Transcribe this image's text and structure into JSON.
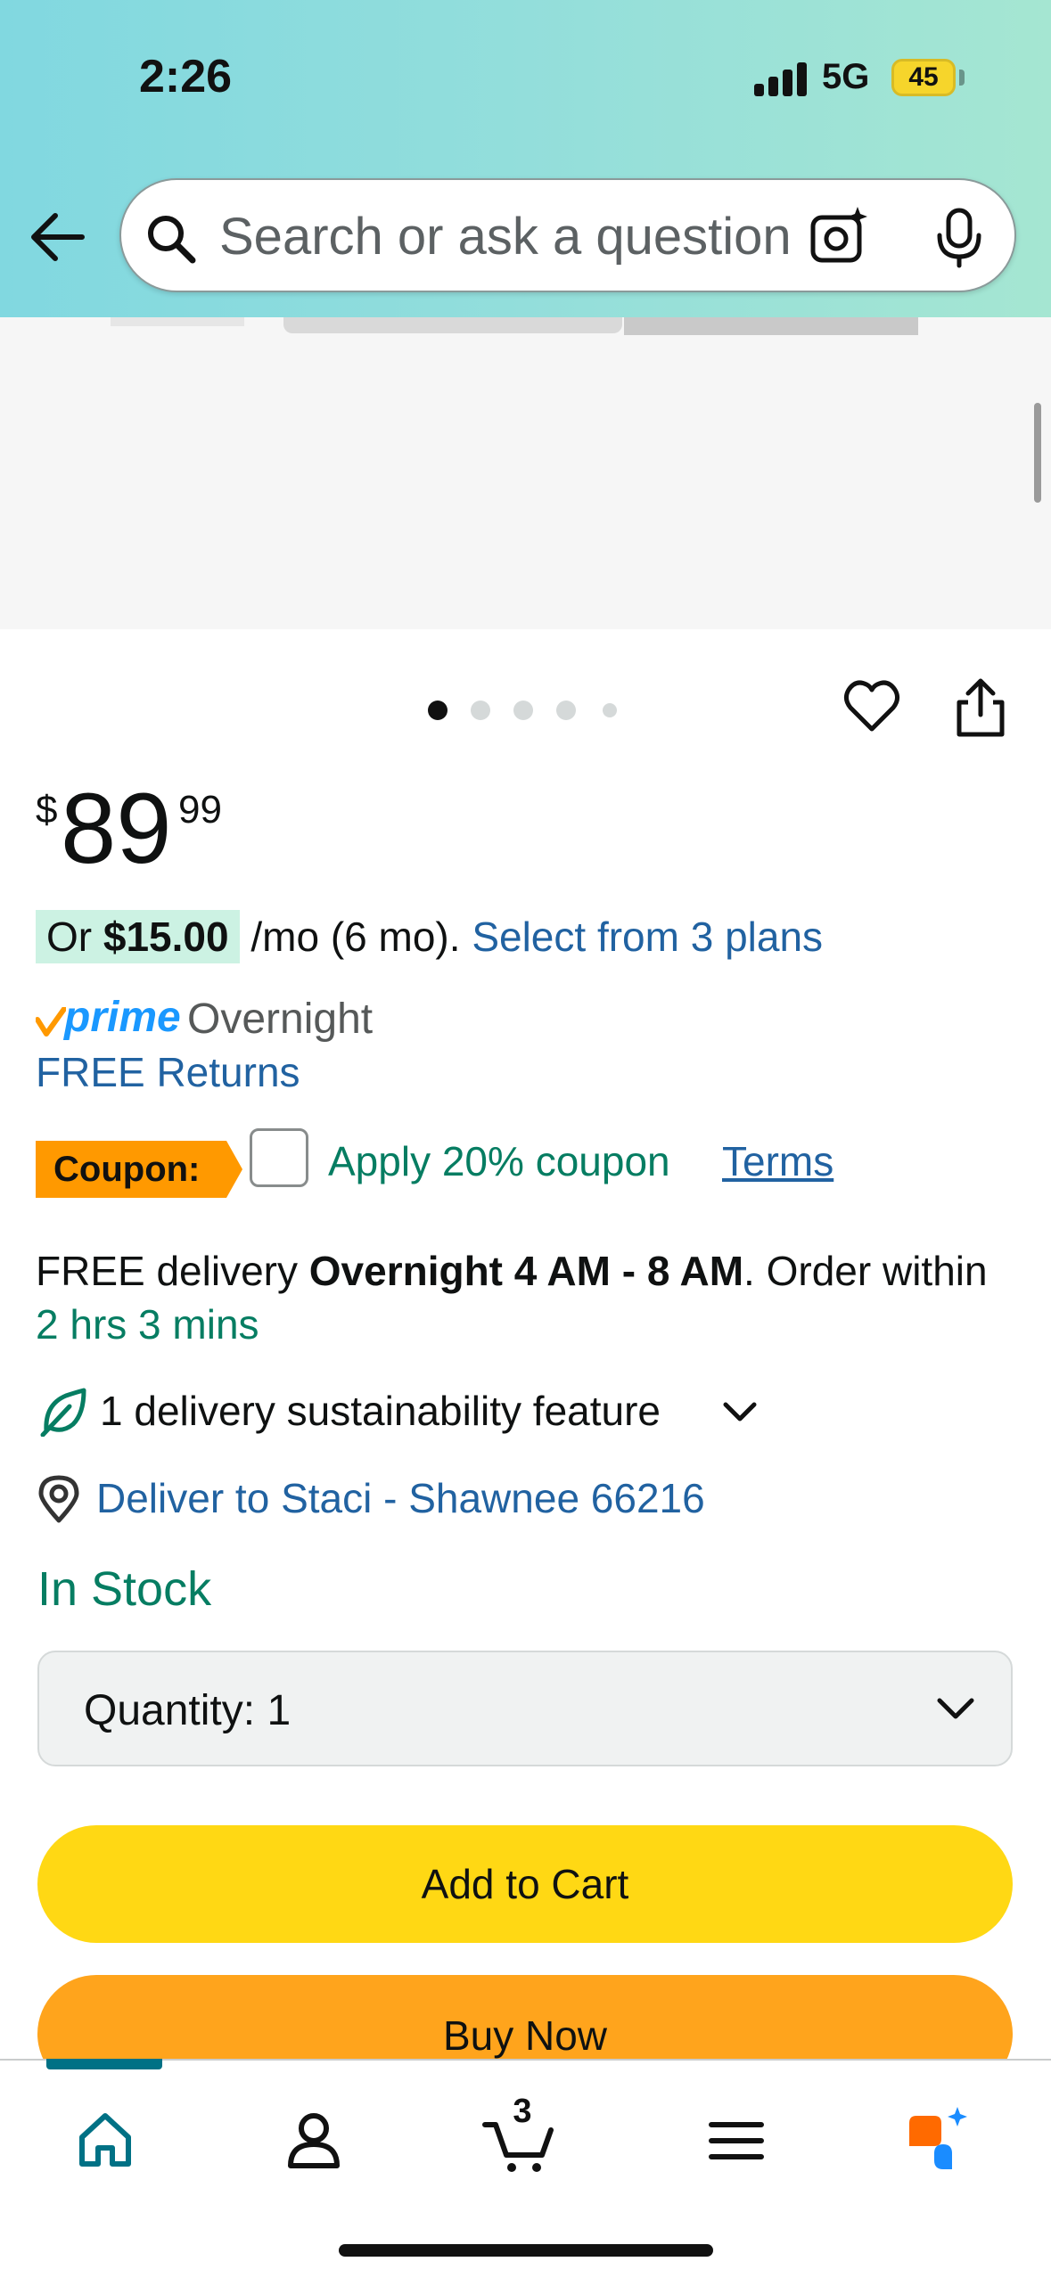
{
  "status_bar": {
    "time": "2:26",
    "network": "5G",
    "battery": "45"
  },
  "search": {
    "placeholder": "Search or ask a question"
  },
  "carousel": {
    "dot_count": 5,
    "active_index": 0
  },
  "product": {
    "price_symbol": "$",
    "price_whole": "89",
    "price_fraction": "99",
    "installment_prefix": "Or ",
    "installment_amount": "$15.00",
    "installment_suffix": " /mo (6 mo). ",
    "installment_link": "Select from 3 plans",
    "prime_label": "prime",
    "prime_speed": "Overnight",
    "free_returns": "FREE Returns",
    "coupon_badge": "Coupon:",
    "coupon_text": "Apply 20% coupon",
    "coupon_terms": "Terms",
    "delivery_prefix": "FREE delivery ",
    "delivery_window": "Overnight 4 AM - 8 AM",
    "delivery_mid": ". Order within ",
    "delivery_countdown": "2 hrs 3 mins",
    "sustainability": "1 delivery sustainability feature",
    "deliver_to": "Deliver to Staci - Shawnee 66216",
    "stock": "In Stock",
    "quantity_label": "Quantity:",
    "quantity_value": "1",
    "add_to_cart": "Add to Cart",
    "buy_now": "Buy Now"
  },
  "tabbar": {
    "cart_count": "3",
    "active_tab": "home"
  },
  "colors": {
    "header_gradient_start": "#81d8e0",
    "header_gradient_end": "#a5e6d2",
    "link_blue": "#2162a1",
    "success_green": "#067d62",
    "add_to_cart_yellow": "#ffd814",
    "buy_now_orange": "#ffa41c",
    "coupon_orange": "#ff9900",
    "tab_active_teal": "#007185"
  },
  "icons": [
    "back-arrow-icon",
    "search-icon",
    "camera-lens-icon",
    "microphone-icon",
    "heart-icon",
    "share-icon",
    "prime-check-icon",
    "leaf-icon",
    "location-pin-icon",
    "chevron-down-icon",
    "home-icon",
    "account-icon",
    "cart-icon",
    "menu-icon",
    "rufus-ai-icon"
  ]
}
